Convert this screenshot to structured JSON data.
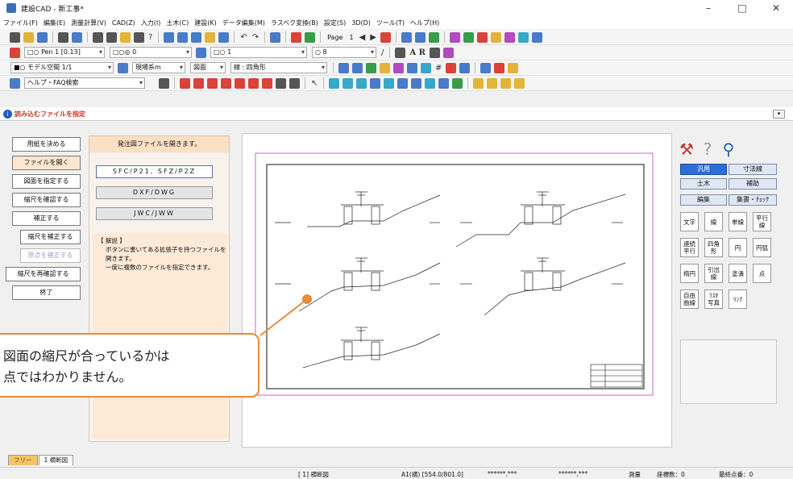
{
  "window": {
    "title": "建設CAD - 新工事*",
    "minimize": "–",
    "maximize": "□",
    "close": "✕"
  },
  "menu": [
    "ファイル(F)",
    "編集(E)",
    "測量計算(V)",
    "CAD(Z)",
    "入力(I)",
    "土木(C)",
    "建設(K)",
    "データ編集(M)",
    "ラスベク変換(B)",
    "設定(S)",
    "3D(D)",
    "ツール(T)",
    "ヘルプ(H)"
  ],
  "toolbar": {
    "page_label": "Page",
    "page_number": "1",
    "pen_combo": "□○ Pen 1 [0.13]",
    "layer_combo": "□○◎ 0",
    "line_combo": "□○ 1",
    "size_combo": "○ 8",
    "space_combo": "■○ モデル空間 1/1",
    "unit_combo": "現場系m",
    "view_combo": "図面",
    "linetype_combo": "線 : 四角形",
    "help_search": "ヘルプ・FAQ検索",
    "text_tools": "A R"
  },
  "info": {
    "prompt": "読み込むファイルを指定"
  },
  "left_buttons": [
    "用紙を決める",
    "ファイルを開く",
    "図面を指定する",
    "縮尺を確認する",
    "補正する",
    "縮尺を補正する",
    "原点を補正する",
    "縮尺を再確認する",
    "終了"
  ],
  "message_panel": {
    "header": "発注図ファイルを開きます。",
    "formats": [
      "SFC/P21, SFZ/P2Z",
      "DXF/DWG",
      "JWC/JWW"
    ],
    "desc_title": "【 解説 】",
    "desc_lines": [
      "ボタンに書いてある拡張子を持つファイルを",
      "開きます。",
      "一度に複数のファイルを指定できます。"
    ]
  },
  "right_panel": {
    "categories": [
      "汎用",
      "寸法線",
      "土木",
      "補助",
      "編集",
      "集書・ﾁｪｯｸ"
    ],
    "tools": [
      "文字",
      "線",
      "単線",
      "平行\n線",
      "連続\n平行",
      "四角\n形",
      "円",
      "円弧",
      "楕円",
      "引出\n線",
      "塗潰",
      "点",
      "自由\n曲線",
      "ﾗｽﾀ\n写真",
      "ﾘﾝｸ"
    ]
  },
  "tabs": [
    "フリー",
    "1 横断図"
  ],
  "status": {
    "view": "[ 1] 横断図",
    "paper": "A1(横) [554.0/801.0]",
    "coord1": "******,***",
    "coord2": "******,***",
    "mode": "測量",
    "coord_count": "座標数：0",
    "last_point": "最終点番：0"
  },
  "callout": {
    "line1": "図面の縮尺が合っているかは",
    "line2": "点ではわかりません。"
  },
  "colors": {
    "accent_orange": "#e88b3a",
    "selected_blue": "#2b6fd6",
    "info_red": "#c0392b"
  }
}
